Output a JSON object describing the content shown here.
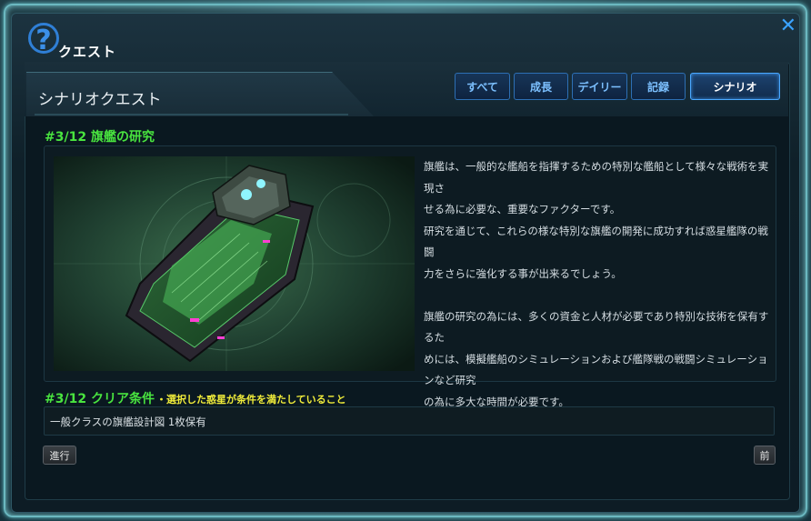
{
  "window": {
    "title": "クエスト"
  },
  "section": {
    "title": "シナリオクエスト"
  },
  "tabs": [
    {
      "label": "すべて"
    },
    {
      "label": "成長"
    },
    {
      "label": "デイリー"
    },
    {
      "label": "記録"
    },
    {
      "label": "シナリオ"
    }
  ],
  "quest": {
    "heading": "#3/12 旗艦の研究",
    "description": [
      "旗艦は、一般的な艦船を指揮するための特別な艦船として様々な戦術を実現さ",
      "せる為に必要な、重要なファクターです。",
      "研究を通じて、これらの様な特別な旗艦の開発に成功すれば惑星艦隊の戦闘",
      "力をさらに強化する事が出来るでしょう。",
      "",
      "旗艦の研究の為には、多くの資金と人材が必要であり特別な技術を保有するた",
      "めには、模擬艦船のシミュレーションおよび艦隊戦の戦闘シミュレーションなど研究",
      "の為に多大な時間が必要です。"
    ]
  },
  "clear": {
    "heading": "#3/12 クリア条件",
    "subtitle": "・選択した惑星が条件を満たしていること",
    "condition": "一般クラスの旗艦設計図 1枚保有"
  },
  "buttons": {
    "progress": "進行",
    "prev": "前"
  },
  "colors": {
    "accent_green": "#49e43f",
    "accent_yellow": "#f0ec3a",
    "tab_blue": "#2d6fb4"
  }
}
